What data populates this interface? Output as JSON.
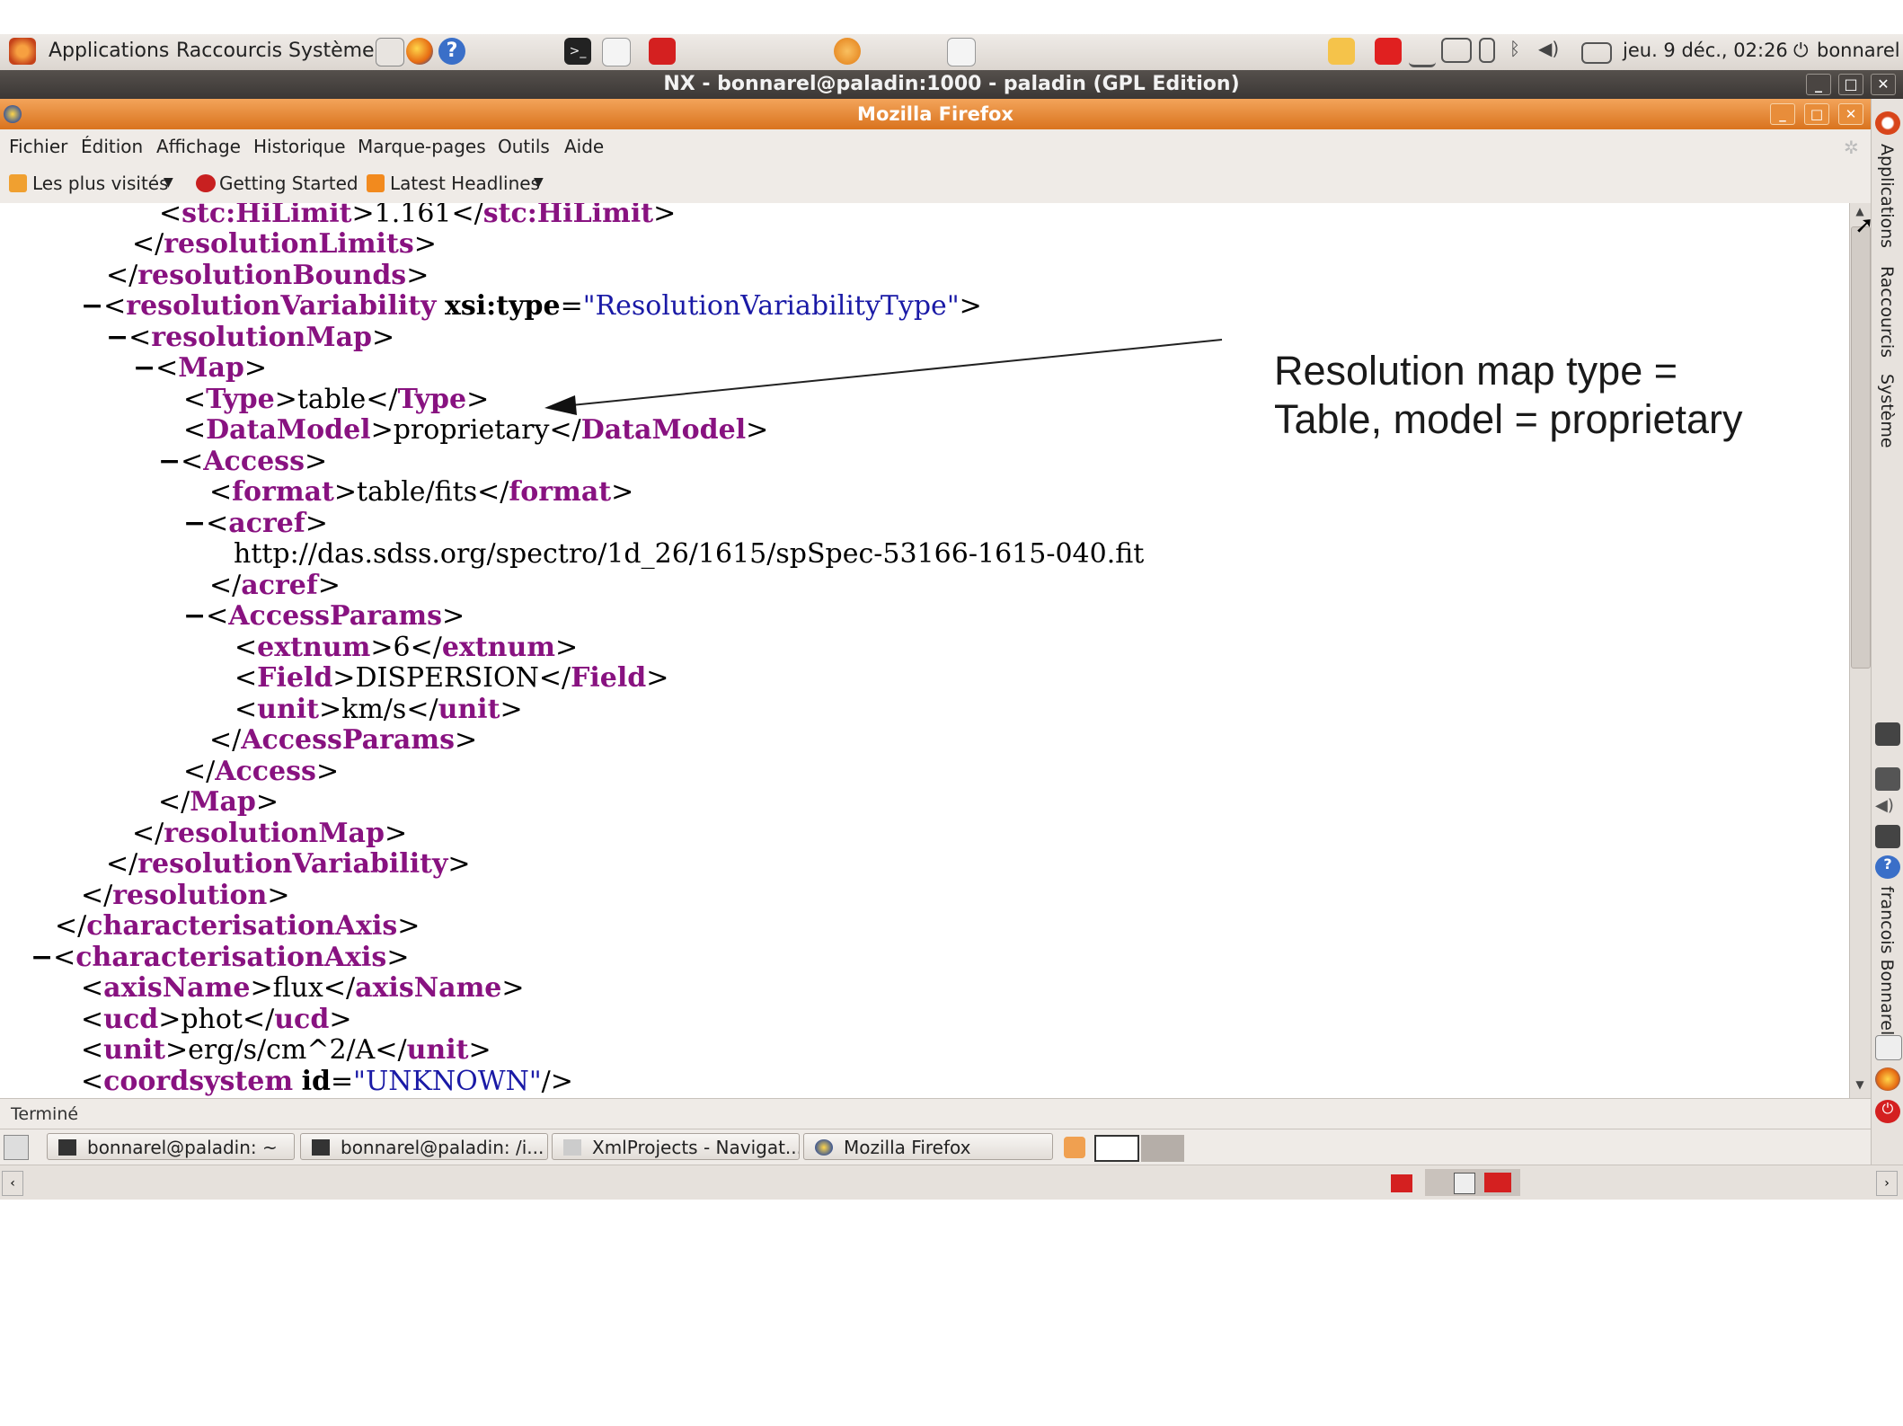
{
  "gnome_panel": {
    "menus": [
      "Applications",
      "Raccourcis",
      "Système"
    ],
    "clock": "jeu.  9 déc., 02:26",
    "user": "bonnarel"
  },
  "nx_window": {
    "title": "NX - bonnarel@paladin:1000 - paladin (GPL Edition)"
  },
  "firefox": {
    "title": "Mozilla Firefox",
    "menus": [
      "Fichier",
      "Édition",
      "Affichage",
      "Historique",
      "Marque-pages",
      "Outils",
      "Aide"
    ],
    "bookmarks": [
      "Les plus visités",
      "Getting Started",
      "Latest Headlines"
    ],
    "status": "Terminé"
  },
  "xml_lines": {
    "l1": {
      "marker": "",
      "open": "stc:HiLimit",
      "text": "1.161",
      "close": "stc:HiLimit"
    },
    "l2": {
      "close": "resolutionLimits"
    },
    "l3": {
      "close": "resolutionBounds"
    },
    "l4": {
      "marker": "−",
      "open": "resolutionVariability",
      "attr_name": "xsi:type",
      "attr_value": "ResolutionVariabilityType"
    },
    "l5": {
      "marker": "−",
      "open": "resolutionMap"
    },
    "l6": {
      "marker": "−",
      "open": "Map"
    },
    "l7": {
      "open": "Type",
      "text": "table",
      "close": "Type"
    },
    "l8": {
      "open": "DataModel",
      "text": "proprietary",
      "close": "DataModel"
    },
    "l9": {
      "marker": "−",
      "open": "Access"
    },
    "l10": {
      "open": "format",
      "text": "table/fits",
      "close": "format"
    },
    "l11": {
      "marker": "−",
      "open": "acref"
    },
    "l12": {
      "text": "http://das.sdss.org/spectro/1d_26/1615/spSpec-53166-1615-040.fit"
    },
    "l13": {
      "close": "acref"
    },
    "l14": {
      "marker": "−",
      "open": "AccessParams"
    },
    "l15": {
      "open": "extnum",
      "text": "6",
      "close": "extnum"
    },
    "l16": {
      "open": "Field",
      "text": "DISPERSION",
      "close": "Field"
    },
    "l17": {
      "open": "unit",
      "text": "km/s",
      "close": "unit"
    },
    "l18": {
      "close": "AccessParams"
    },
    "l19": {
      "close": "Access"
    },
    "l20": {
      "close": "Map"
    },
    "l21": {
      "close": "resolutionMap"
    },
    "l22": {
      "close": "resolutionVariability"
    },
    "l23": {
      "close": "resolution"
    },
    "l24": {
      "close": "characterisationAxis"
    },
    "l25": {
      "marker": "−",
      "open": "characterisationAxis"
    },
    "l26": {
      "open": "axisName",
      "text": "flux",
      "close": "axisName"
    },
    "l27": {
      "open": "ucd",
      "text": "phot",
      "close": "ucd"
    },
    "l28": {
      "open": "unit",
      "text": "erg/s/cm^2/A",
      "close": "unit"
    },
    "l29": {
      "open": "coordsystem",
      "attr_name": "id",
      "attr_value": "UNKNOWN"
    }
  },
  "annotation": {
    "line1": "Resolution map type =",
    "line2": "Table, model = proprietary"
  },
  "taskbar": {
    "items": [
      "bonnarel@paladin: ~",
      "bonnarel@paladin: /i...",
      "XmlProjects - Navigat...",
      "Mozilla Firefox"
    ]
  },
  "side_panel": {
    "labels": [
      "Applications",
      "Raccourcis",
      "Système",
      "francois Bonnarel"
    ]
  },
  "colors": {
    "tag": "#881280",
    "attr_value": "#1a1aa6",
    "firefox_title": "#e8832e"
  }
}
